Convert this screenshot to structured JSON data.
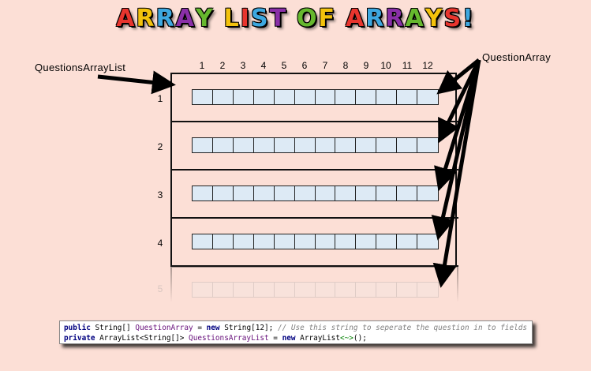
{
  "title": {
    "text": "ARRAY LIST OF ARRAYS!",
    "letter_colors": [
      "#e8352e",
      "#f3c20c",
      "#3da8e0",
      "#8a2fa8",
      "#66b82e",
      "#f3c20c",
      "#e8352e",
      "#3da8e0",
      "#8a2fa8",
      "#66b82e",
      "#f3c20c",
      "#e8352e",
      "#3da8e0",
      "#8a2fa8",
      "#66b82e",
      "#f3c20c",
      "#e8352e",
      "#3da8e0",
      "#8a2fa8",
      "#66b82e",
      "#f3c20c"
    ]
  },
  "labels": {
    "list": "QuestionsArrayList",
    "array": "QuestionArray"
  },
  "columns": [
    "1",
    "2",
    "3",
    "4",
    "5",
    "6",
    "7",
    "8",
    "9",
    "10",
    "11",
    "12"
  ],
  "rows": [
    "1",
    "2",
    "3",
    "4"
  ],
  "faded_row": "5",
  "code": {
    "line1": {
      "kw": "public",
      "type": " String[] ",
      "field": "QuestionArray",
      "mid": " = ",
      "kw2": "new",
      "rest": " String[12]; ",
      "comment": "// Use this string to seperate the question in to fields"
    },
    "line2": {
      "kw": "private",
      "type": " ArrayList<String[]> ",
      "field": "QuestionsArrayList",
      "mid": " = ",
      "kw2": "new",
      "rest": " ArrayList",
      "generic": "<~>",
      "end": "();"
    }
  },
  "colors": {
    "background": "#fcdfd6",
    "cell_fill": "#ddeaf5",
    "border": "#111111"
  }
}
